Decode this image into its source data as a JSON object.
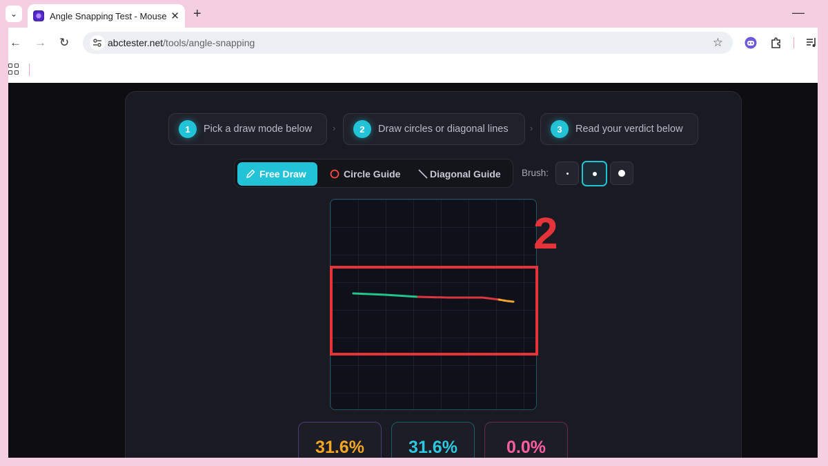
{
  "browser": {
    "tab_title": "Angle Snapping Test - Mouse P",
    "url_domain": "abctester.net",
    "url_path": "/tools/angle-snapping"
  },
  "steps": [
    {
      "num": "1",
      "label": "Pick a draw mode below"
    },
    {
      "num": "2",
      "label": "Draw circles or diagonal lines"
    },
    {
      "num": "3",
      "label": "Read your verdict below"
    }
  ],
  "modes": {
    "free_draw": "Free Draw",
    "circle_guide": "Circle Guide",
    "diagonal_guide": "Diagonal Guide",
    "active": "free_draw"
  },
  "brush": {
    "label": "Brush:",
    "sizes": [
      "small",
      "medium",
      "large"
    ],
    "selected": "medium"
  },
  "stats": [
    {
      "value": "31.6%",
      "color": "#f5a623",
      "border": "#4b3a7a"
    },
    {
      "value": "31.6%",
      "color": "#2ec9e0",
      "border": "#1e5c6a"
    },
    {
      "value": "0.0%",
      "color": "#ff5fa2",
      "border": "#6a2d4c"
    }
  ],
  "stroke_colors": {
    "snapped_segment": "#22c58a",
    "deviating_segment": "#d9363e",
    "end_segment": "#f1a430"
  },
  "annotation": {
    "number": "2",
    "color": "#e5333a"
  }
}
